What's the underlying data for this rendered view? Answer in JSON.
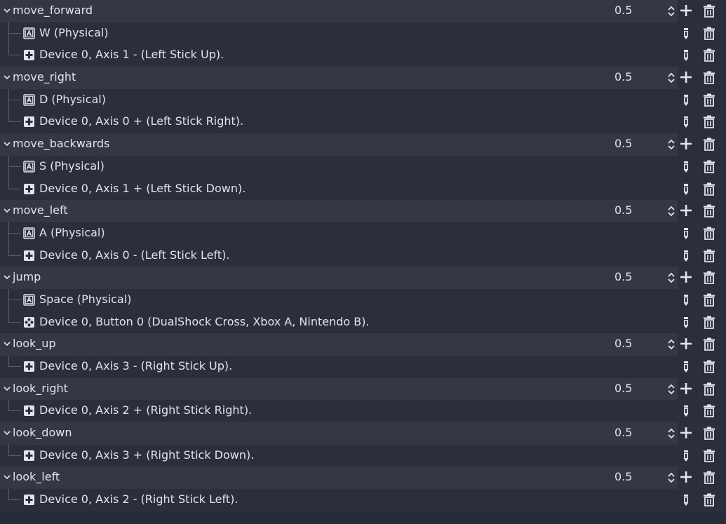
{
  "actions": [
    {
      "name": "move_forward",
      "deadzone": "0.5",
      "events": [
        {
          "type": "key",
          "label": "W (Physical)"
        },
        {
          "type": "axis",
          "label": "Device 0, Axis 1 - (Left Stick Up)."
        }
      ]
    },
    {
      "name": "move_right",
      "deadzone": "0.5",
      "events": [
        {
          "type": "key",
          "label": "D (Physical)"
        },
        {
          "type": "axis",
          "label": "Device 0, Axis 0 + (Left Stick Right)."
        }
      ]
    },
    {
      "name": "move_backwards",
      "deadzone": "0.5",
      "events": [
        {
          "type": "key",
          "label": "S (Physical)"
        },
        {
          "type": "axis",
          "label": "Device 0, Axis 1 + (Left Stick Down)."
        }
      ]
    },
    {
      "name": "move_left",
      "deadzone": "0.5",
      "events": [
        {
          "type": "key",
          "label": "A (Physical)"
        },
        {
          "type": "axis",
          "label": "Device 0, Axis 0 - (Left Stick Left)."
        }
      ]
    },
    {
      "name": "jump",
      "deadzone": "0.5",
      "events": [
        {
          "type": "key",
          "label": "Space (Physical)"
        },
        {
          "type": "button",
          "label": "Device 0, Button 0 (DualShock Cross, Xbox A, Nintendo B)."
        }
      ]
    },
    {
      "name": "look_up",
      "deadzone": "0.5",
      "events": [
        {
          "type": "axis",
          "label": "Device 0, Axis 3 - (Right Stick Up)."
        }
      ]
    },
    {
      "name": "look_right",
      "deadzone": "0.5",
      "events": [
        {
          "type": "axis",
          "label": "Device 0, Axis 2 + (Right Stick Right)."
        }
      ]
    },
    {
      "name": "look_down",
      "deadzone": "0.5",
      "events": [
        {
          "type": "axis",
          "label": "Device 0, Axis 3 + (Right Stick Down)."
        }
      ]
    },
    {
      "name": "look_left",
      "deadzone": "0.5",
      "events": [
        {
          "type": "axis",
          "label": "Device 0, Axis 2 - (Right Stick Left)."
        }
      ]
    }
  ],
  "icons": {
    "collapse": "chevron-down-icon",
    "spin": "up-down-spinner-icon",
    "add": "plus-icon",
    "remove": "trash-icon",
    "edit": "pencil-icon",
    "key": "keyboard-key-icon",
    "axis": "gamepad-dpad-icon",
    "button": "gamepad-buttons-icon"
  },
  "colors": {
    "background": "#282c38",
    "action_row": "#343845",
    "event_row": "#2b2f3b",
    "text": "#e2e4ea"
  }
}
